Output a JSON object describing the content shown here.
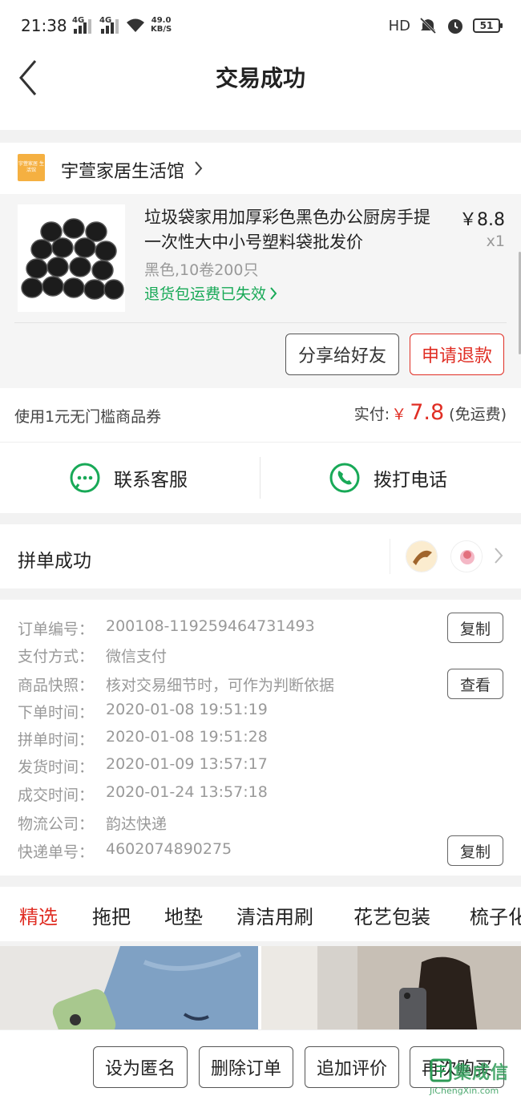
{
  "status_bar": {
    "time": "21:38",
    "signal1": "4G",
    "signal2": "4G",
    "speed_value": "49.0",
    "speed_unit": "KB/S",
    "hd_label": "HD",
    "battery": "51"
  },
  "header": {
    "title": "交易成功"
  },
  "shop": {
    "name": "宇萱家居生活馆",
    "logo_text": "宇萱家居 生活馆"
  },
  "goods": {
    "name": "垃圾袋家用加厚彩色黑色办公厨房手提一次性大中小号塑料袋批发价",
    "price": "￥8.8",
    "qty": "x1",
    "spec": "黑色,10卷200只",
    "return_note": "退货包运费已失效",
    "share_label": "分享给好友",
    "refund_label": "申请退款"
  },
  "payment": {
    "coupon": "使用1元无门槛商品券",
    "paid_label": "实付:",
    "currency": "￥",
    "amount": "7.8",
    "shipping": "(免运费)"
  },
  "contact": {
    "service_label": "联系客服",
    "phone_label": "拨打电话"
  },
  "group": {
    "label": "拼单成功"
  },
  "order": {
    "rows": [
      {
        "key": "订单编号：",
        "value": "200108-119259464731493"
      },
      {
        "key": "支付方式：",
        "value": "微信支付"
      },
      {
        "key": "商品快照：",
        "value": "核对交易细节时，可作为判断依据"
      },
      {
        "key": "下单时间：",
        "value": "2020-01-08 19:51:19"
      },
      {
        "key": "拼单时间：",
        "value": "2020-01-08 19:51:28"
      },
      {
        "key": "发货时间：",
        "value": "2020-01-09 13:57:17"
      },
      {
        "key": "成交时间：",
        "value": "2020-01-24 13:57:18"
      },
      {
        "key": "物流公司：",
        "value": "韵达快递"
      },
      {
        "key": "快递单号：",
        "value": "4602074890275"
      }
    ],
    "copy_label": "复制",
    "view_label": "查看"
  },
  "categories": [
    "精选",
    "拖把",
    "地垫",
    "清洁用刷",
    "花艺包装",
    "梳子化"
  ],
  "bottom_bar": {
    "anonymous": "设为匿名",
    "delete": "删除订单",
    "append_review": "追加评价",
    "rebuy": "再次购买"
  },
  "watermark": {
    "text": "集成信",
    "url": "JiChengXin.com"
  },
  "colors": {
    "accent": "#e02e24",
    "green": "#18a957"
  }
}
